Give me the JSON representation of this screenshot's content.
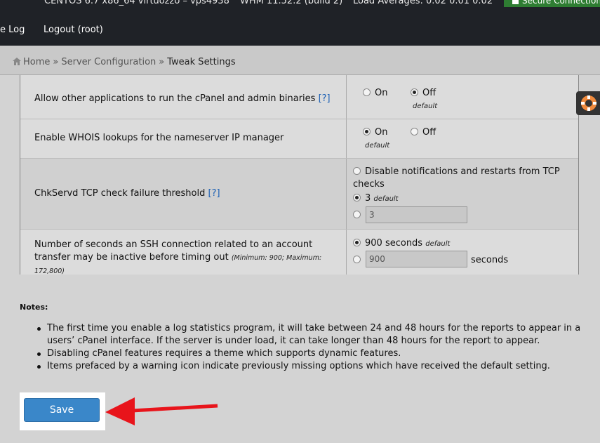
{
  "topbar": {
    "hostname": "CENTOS 6.7 x86_64 virtuozzo – vps4938",
    "version": "WHM 11.52.2 (build 2)",
    "load": "Load Averages: 0.02 0.01 0.02",
    "secure": "Secure Connection",
    "nav": [
      "e Log",
      "Logout (root)"
    ]
  },
  "breadcrumb": {
    "items": [
      "Home",
      "Server Configuration",
      "Tweak Settings"
    ],
    "separator": "»"
  },
  "settings": [
    {
      "label": "Allow other applications to run the cPanel and admin binaries",
      "help": "[?]",
      "options": [
        "On",
        "Off"
      ],
      "selected": "Off",
      "default_label": "default"
    },
    {
      "label": "Enable WHOIS lookups for the nameserver IP manager",
      "options": [
        "On",
        "Off"
      ],
      "selected": "On",
      "default_label": "default"
    },
    {
      "label": "ChkServd TCP check failure threshold",
      "help": "[?]",
      "option_disable": "Disable notifications and restarts from TCP checks",
      "option_default_value": "3",
      "default_label": "default",
      "custom_value": "3"
    },
    {
      "label": "Number of seconds an SSH connection related to an account transfer may be inactive before timing out",
      "minmax": "(Minimum: 900; Maximum: 172,800)",
      "option_default_value": "900 seconds",
      "default_label": "default",
      "custom_value": "900",
      "unit": "seconds"
    }
  ],
  "notes": {
    "title": "Notes:",
    "items": [
      "The first time you enable a log statistics program, it will take between 24 and 48 hours for the reports to appear in a users’ cPanel interface. If the server is under load, it can take longer than 48 hours for the report to appear.",
      "Disabling cPanel features requires a theme which supports dynamic features.",
      "Items prefaced by a warning icon indicate previously missing options which have received the default setting."
    ]
  },
  "save_label": "Save",
  "colors": {
    "topbar": "#1f2227",
    "accent_button": "#3a87c9",
    "arrow": "#e8141b",
    "secure_badge": "#2e7d32"
  }
}
